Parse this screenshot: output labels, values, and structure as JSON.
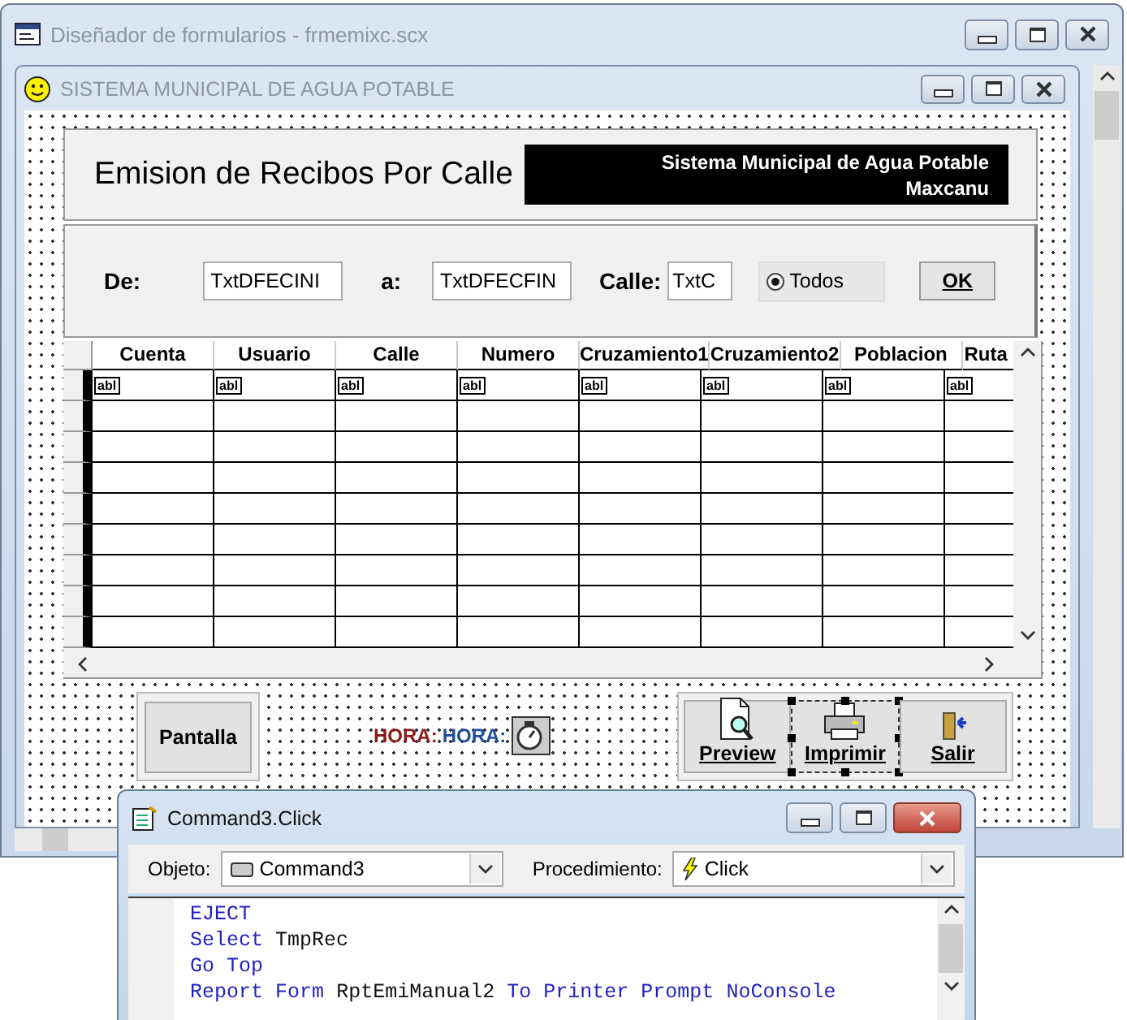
{
  "designer_window": {
    "title": "Diseñador de formularios - frmemixc.scx"
  },
  "form_window": {
    "title": "SISTEMA MUNICIPAL DE AGUA POTABLE"
  },
  "header": {
    "title": "Emision de Recibos Por Calle",
    "banner_lines": [
      "Sistema Municipal de Agua Potable",
      "Maxcanu"
    ]
  },
  "filters": [
    {
      "label": "De:",
      "value": "TxtDFECINI"
    },
    {
      "label": "a:",
      "value": "TxtDFECFIN"
    },
    {
      "label": "Calle:",
      "value": "TxtC"
    }
  ],
  "radio": {
    "label": "Todos",
    "selected": true
  },
  "ok_button": "OK",
  "grid": {
    "columns": [
      {
        "header": "Cuenta",
        "control": "abl"
      },
      {
        "header": "Usuario",
        "control": "abl"
      },
      {
        "header": "Calle",
        "control": "abl"
      },
      {
        "header": "Numero",
        "control": "abl"
      },
      {
        "header": "Cruzamiento1",
        "control": "abl"
      },
      {
        "header": "Cruzamiento2",
        "control": "abl"
      },
      {
        "header": "Poblacion",
        "control": "abl"
      },
      {
        "header": "Ruta",
        "control": "abl"
      }
    ]
  },
  "pantalla_button": "Pantalla",
  "hora_labels": [
    {
      "text": "HORA:",
      "color": "#8b1a1a"
    },
    {
      "text": "HORA:",
      "color": "#1f4e9c"
    }
  ],
  "action_buttons": [
    {
      "label": "Preview",
      "kind": "preview",
      "selected": false
    },
    {
      "label": "Imprimir",
      "kind": "print",
      "selected": true
    },
    {
      "label": "Salir",
      "kind": "exit",
      "selected": false
    }
  ],
  "code_window": {
    "title": "Command3.Click",
    "object_label": "Objeto:",
    "object_value": "Command3",
    "procedure_label": "Procedimiento:",
    "procedure_value": "Click",
    "lines": [
      [
        {
          "kind": "keyword",
          "text": "EJECT"
        }
      ],
      [
        {
          "kind": "keyword",
          "text": "Select"
        },
        {
          "kind": "name",
          "text": "TmpRec"
        }
      ],
      [
        {
          "kind": "keyword",
          "text": "Go"
        },
        {
          "kind": "keyword",
          "text": "Top"
        }
      ],
      [
        {
          "kind": "keyword",
          "text": "Report"
        },
        {
          "kind": "keyword",
          "text": "Form"
        },
        {
          "kind": "name",
          "text": "RptEmiManual2"
        },
        {
          "kind": "keyword",
          "text": "To"
        },
        {
          "kind": "keyword",
          "text": "Printer"
        },
        {
          "kind": "keyword",
          "text": "Prompt"
        },
        {
          "kind": "keyword",
          "text": "NoConsole"
        }
      ]
    ]
  }
}
